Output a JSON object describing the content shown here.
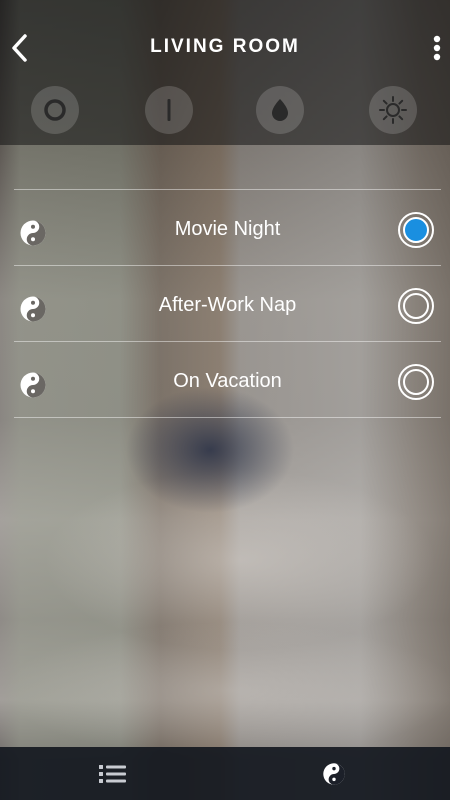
{
  "header": {
    "title": "LIVING ROOM",
    "back_icon": "chevron-left-icon",
    "more_icon": "more-vertical-icon"
  },
  "modes": [
    {
      "icon": "circle-mode-icon"
    },
    {
      "icon": "line-mode-icon"
    },
    {
      "icon": "drop-mode-icon"
    },
    {
      "icon": "sun-mode-icon"
    }
  ],
  "scenes": [
    {
      "label": "Movie Night",
      "icon": "yin-yang-icon",
      "selected": true
    },
    {
      "label": "After-Work Nap",
      "icon": "yin-yang-icon",
      "selected": false
    },
    {
      "label": "On Vacation",
      "icon": "yin-yang-icon",
      "selected": false
    }
  ],
  "tabbar": {
    "tabs": [
      {
        "icon": "list-icon"
      },
      {
        "icon": "yin-yang-icon"
      }
    ]
  },
  "colors": {
    "accent": "#1a8fe0",
    "header_overlay": "rgba(20,20,20,0.55)",
    "tabbar": "#12161e"
  }
}
